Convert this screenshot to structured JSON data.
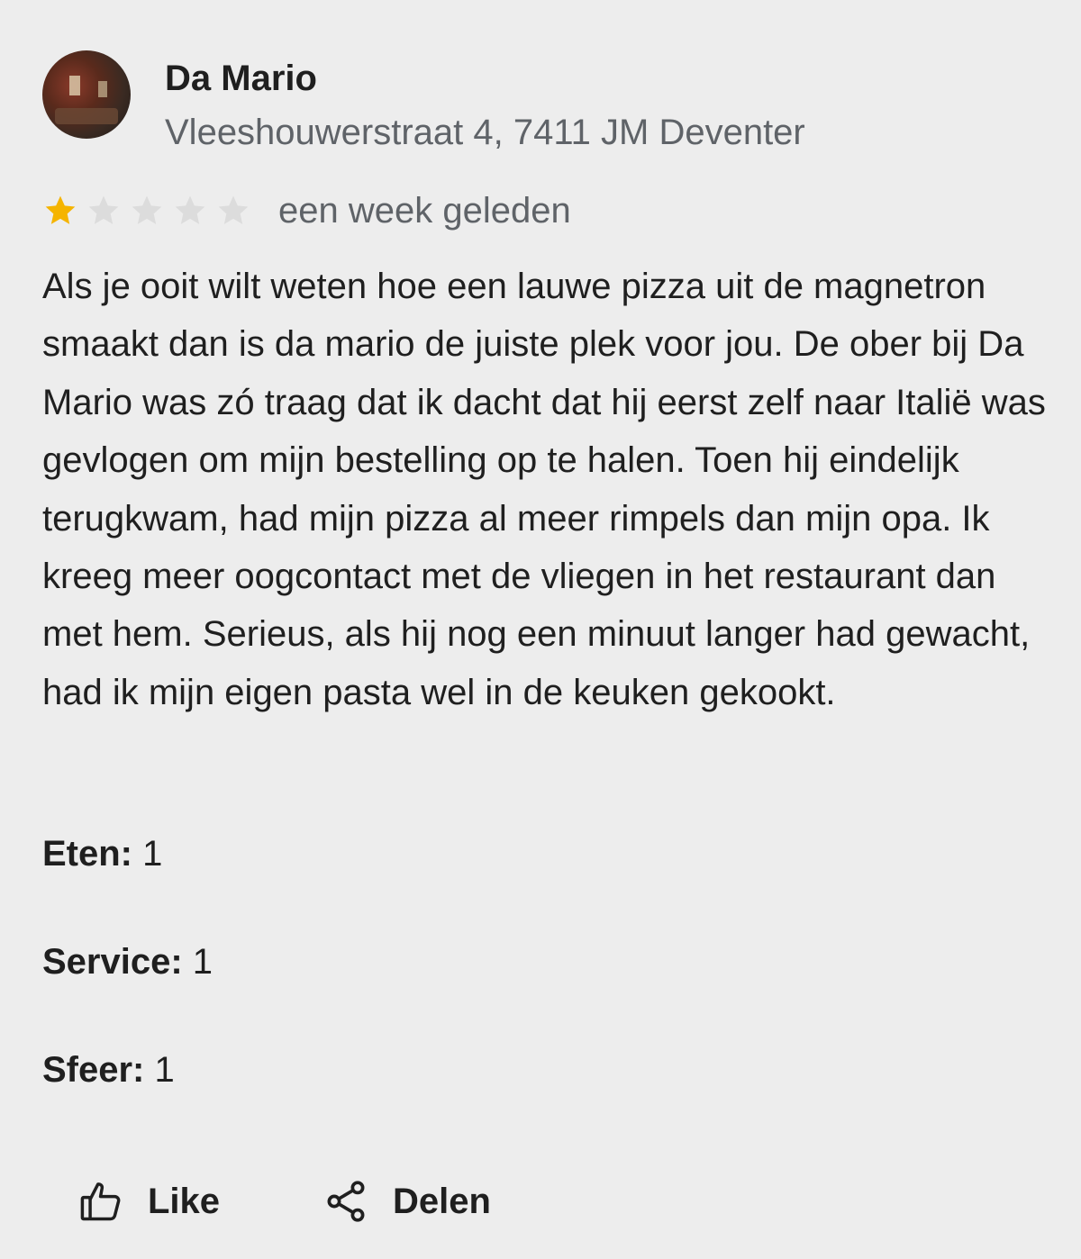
{
  "place": {
    "name": "Da Mario",
    "address": "Vleeshouwerstraat 4, 7411 JM Deventer"
  },
  "review": {
    "rating": 1,
    "rating_max": 5,
    "date": "een week geleden",
    "text": "Als je ooit wilt weten hoe een lauwe pizza uit de magnetron smaakt dan is da mario de juiste plek voor jou. De ober bij Da Mario was zó traag dat ik dacht dat hij eerst zelf naar Italië was gevlogen om mijn bestelling op te halen. Toen hij eindelijk terugkwam, had mijn pizza al meer rimpels dan mijn opa. Ik kreeg meer oogcontact met de vliegen in het restaurant dan met hem. Serieus, als hij nog een minuut langer had gewacht, had ik mijn eigen pasta wel in de keuken gekookt."
  },
  "scores": [
    {
      "label": "Eten:",
      "value": "1"
    },
    {
      "label": "Service:",
      "value": "1"
    },
    {
      "label": "Sfeer:",
      "value": "1"
    }
  ],
  "actions": {
    "like_label": "Like",
    "like_icon": "thumbs-up-icon",
    "share_label": "Delen",
    "share_icon": "share-icon"
  },
  "colors": {
    "star_filled": "#f5b400",
    "star_empty": "#dcdcdc",
    "background": "#ededed",
    "secondary_text": "#5f6368"
  }
}
